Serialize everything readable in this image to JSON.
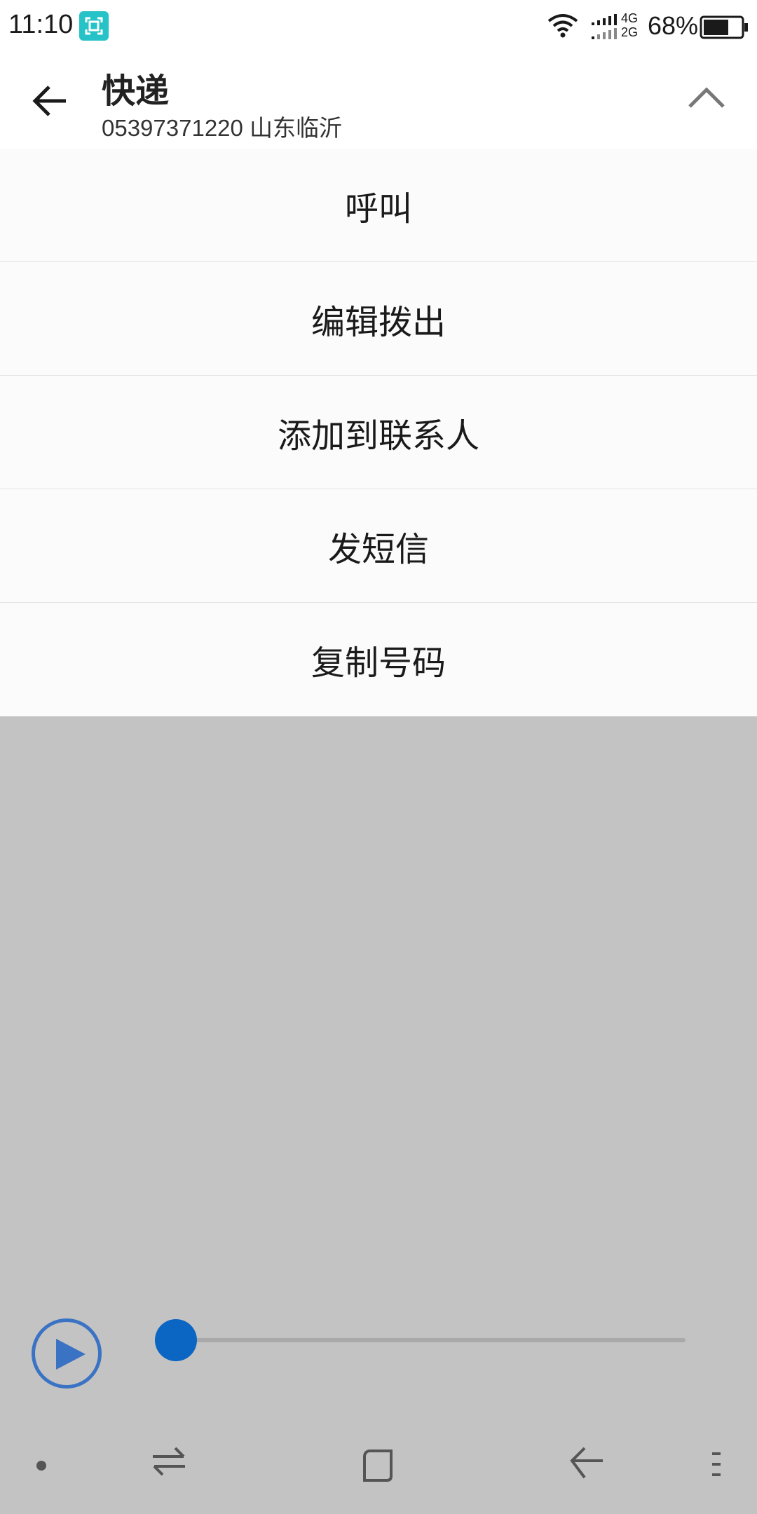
{
  "status_bar": {
    "time": "11:10",
    "network_top": "4G",
    "network_bottom": "2G",
    "battery_percent": "68%",
    "battery_level": 0.68
  },
  "header": {
    "title": "快递",
    "subtitle": "05397371220 山东临沂"
  },
  "menu": {
    "items": [
      {
        "label": "呼叫"
      },
      {
        "label": "编辑拨出"
      },
      {
        "label": "添加到联系人"
      },
      {
        "label": "发短信"
      },
      {
        "label": "复制号码"
      }
    ]
  },
  "player": {
    "progress": 0.0
  },
  "colors": {
    "accent": "#0b65c2",
    "play_ring": "#3b73c4",
    "overlay": "#c3c3c3",
    "badge": "#25c3c7"
  }
}
